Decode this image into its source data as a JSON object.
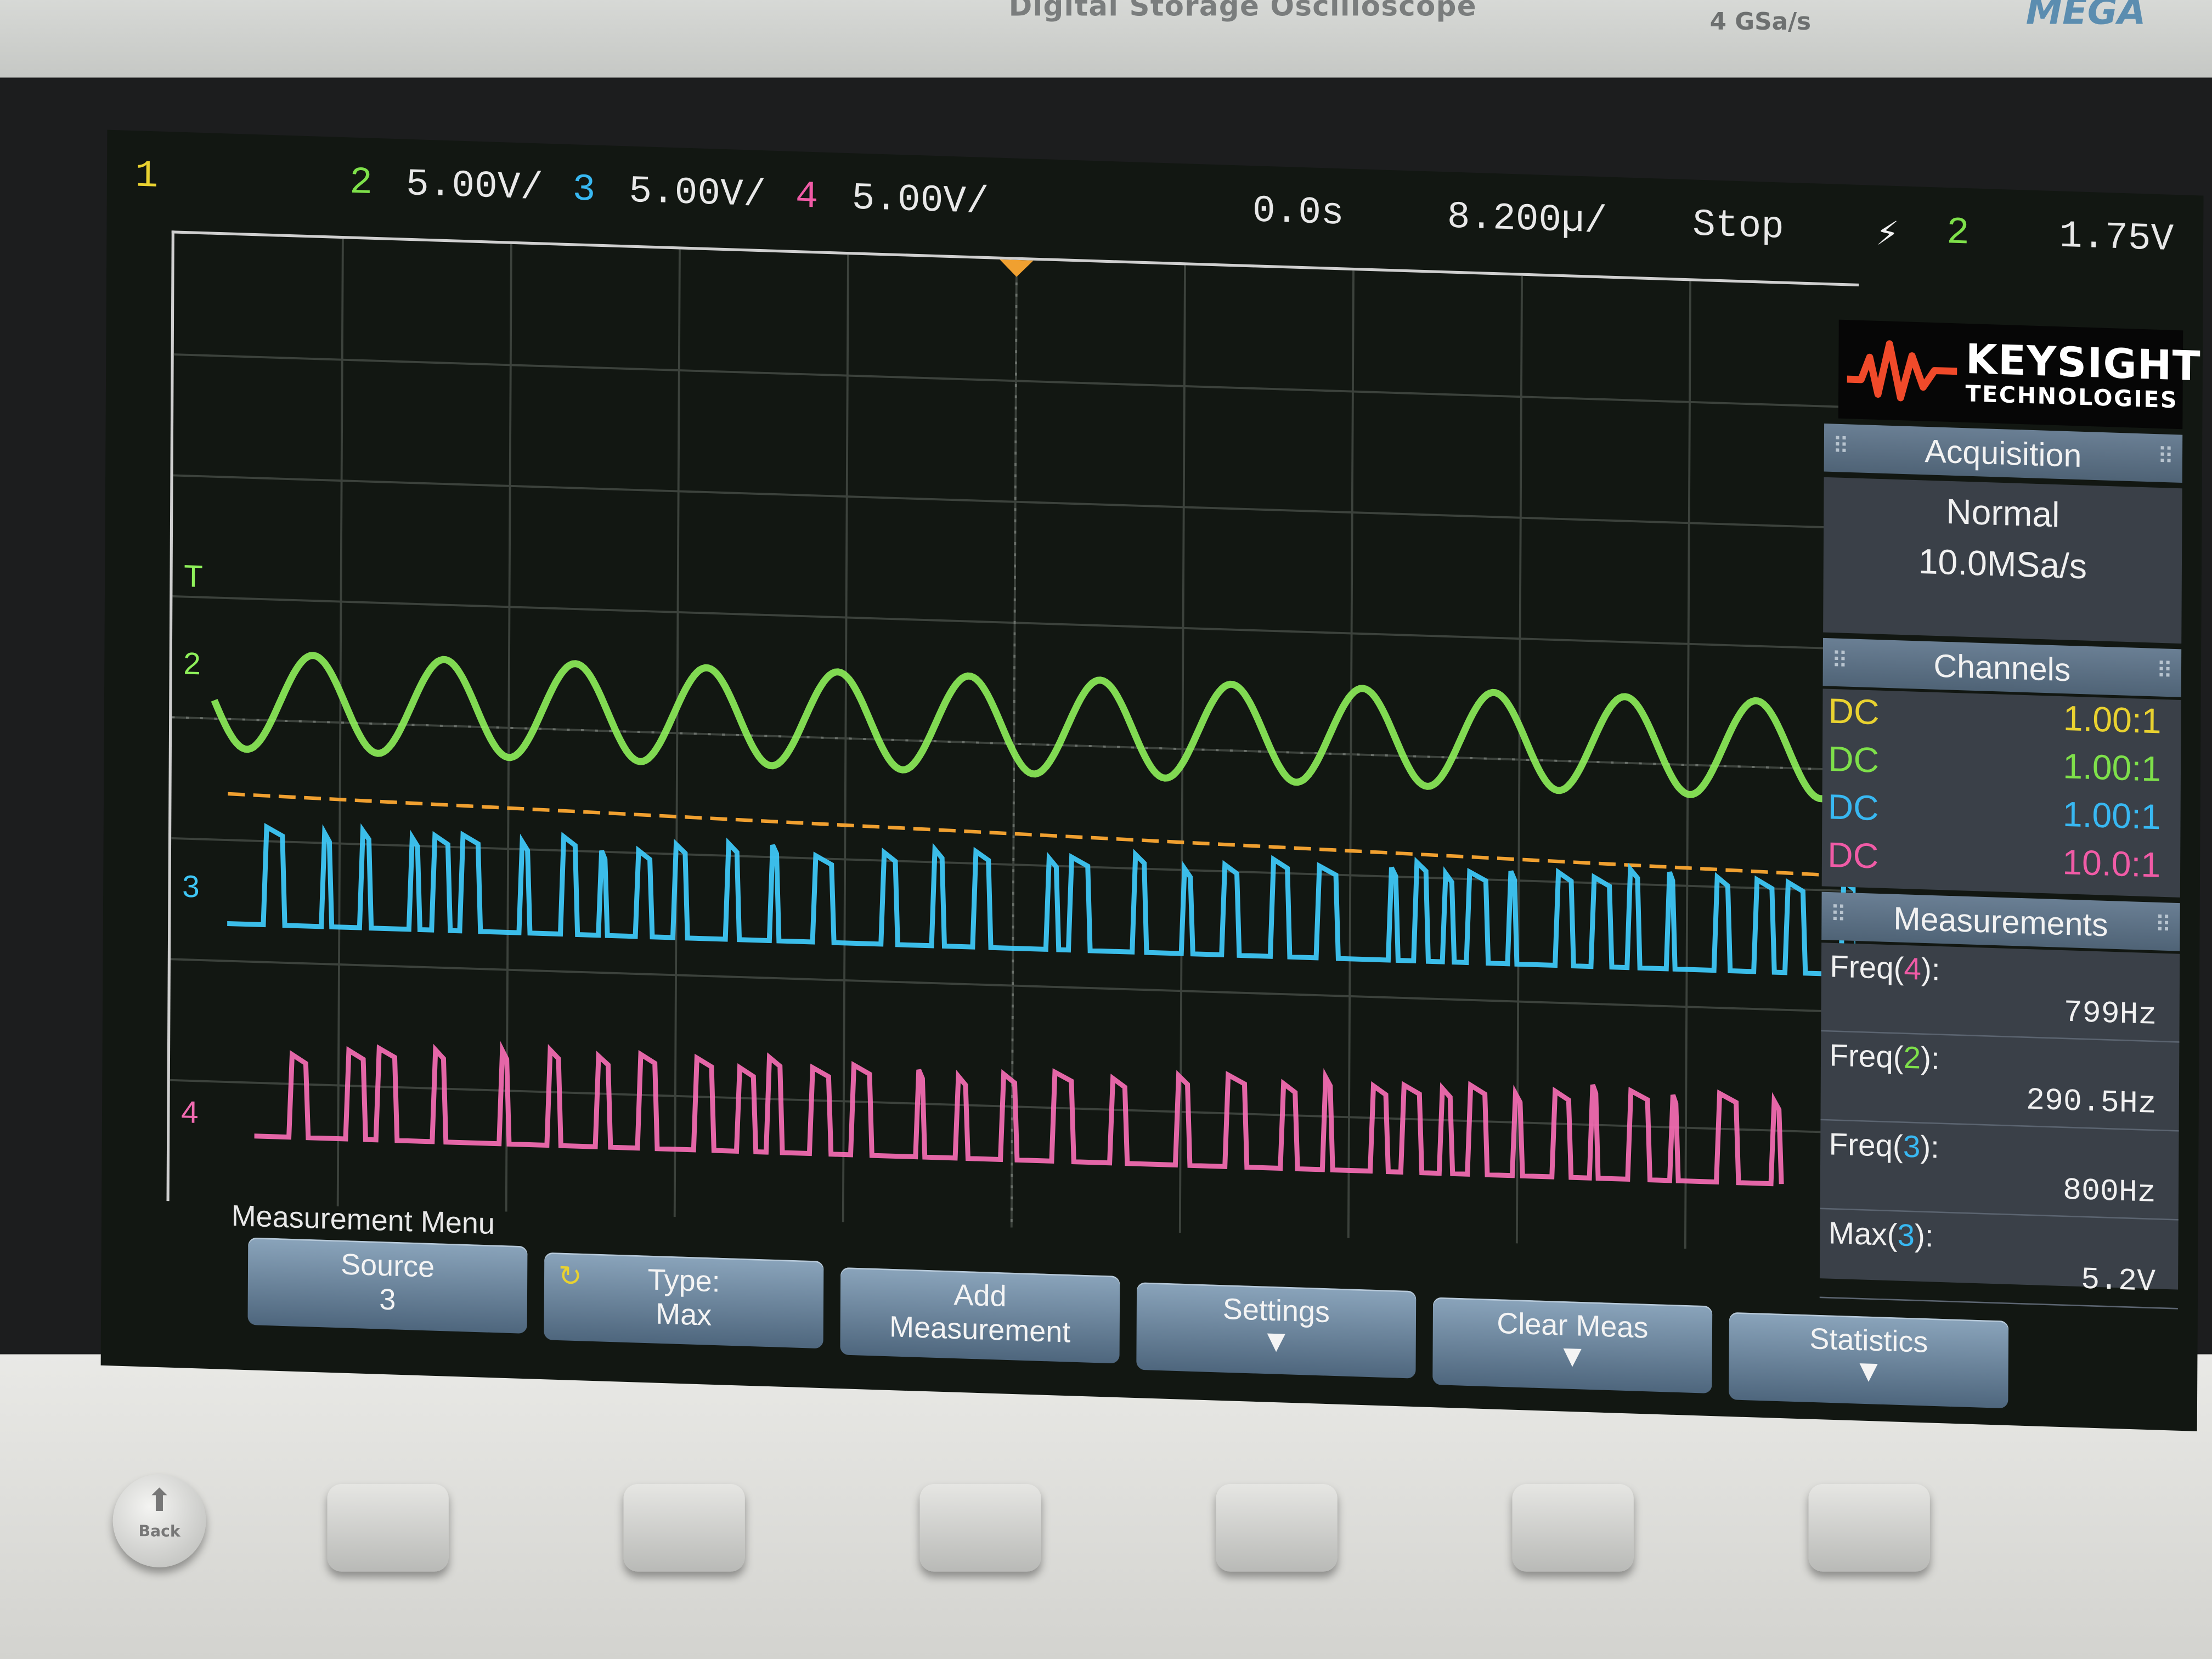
{
  "instrument": {
    "model_text": "Digital Storage Oscilloscope",
    "sample_rate_label": "4 GSa/s",
    "brand_fragment": "MEGA"
  },
  "header": {
    "ch1_label": "1",
    "ch2_label": "2",
    "ch2_scale": "5.00V/",
    "ch3_label": "3",
    "ch3_scale": "5.00V/",
    "ch4_label": "4",
    "ch4_scale": "5.00V/",
    "time_delay": "0.0s",
    "time_scale": "8.200µ/",
    "run_state": "Stop",
    "trigger_icon": "⚡",
    "trigger_source": "2",
    "trigger_level": "1.75V"
  },
  "logo": {
    "name": "KEYSIGHT",
    "subtitle": "TECHNOLOGIES"
  },
  "acquisition": {
    "title": "Acquisition",
    "mode": "Normal",
    "rate": "10.0MSa/s"
  },
  "channels": {
    "title": "Channels",
    "rows": [
      {
        "coupling": "DC",
        "probe": "1.00:1",
        "color": "#e9d230"
      },
      {
        "coupling": "DC",
        "probe": "1.00:1",
        "color": "#7ee04a"
      },
      {
        "coupling": "DC",
        "probe": "1.00:1",
        "color": "#38b8f2"
      },
      {
        "coupling": "DC",
        "probe": "10.0:1",
        "color": "#f05ba6"
      }
    ]
  },
  "measurements": {
    "title": "Measurements",
    "items": [
      {
        "name": "Freq(",
        "channel": "4",
        "close": "):",
        "value": "799Hz",
        "color": "#f05ba6"
      },
      {
        "name": "Freq(",
        "channel": "2",
        "close": "):",
        "value": "290.5Hz",
        "color": "#7ee04a"
      },
      {
        "name": "Freq(",
        "channel": "3",
        "close": "):",
        "value": "800Hz",
        "color": "#38b8f2"
      },
      {
        "name": "Max(",
        "channel": "3",
        "close": "):",
        "value": "5.2V",
        "color": "#38b8f2"
      }
    ]
  },
  "waveforms": {
    "ch2_marker": "2",
    "ch3_marker": "3",
    "ch4_marker": "4",
    "trigger_marker": "T",
    "colors": {
      "ch2": "#8ef05a",
      "ch3": "#3ec6f5",
      "ch4": "#f06ab0",
      "trigger_level": "#f0a030"
    }
  },
  "menu": {
    "title": "Measurement Menu",
    "softkeys": [
      {
        "line1": "Source",
        "line2": "3"
      },
      {
        "line1": "Type:",
        "line2": "Max"
      },
      {
        "line1": "Add",
        "line2": "Measurement"
      },
      {
        "line1": "Settings",
        "line2": "▼"
      },
      {
        "line1": "Clear Meas",
        "line2": "▼"
      },
      {
        "line1": "Statistics",
        "line2": "▼"
      }
    ]
  },
  "front_panel": {
    "back_label": "Back"
  }
}
